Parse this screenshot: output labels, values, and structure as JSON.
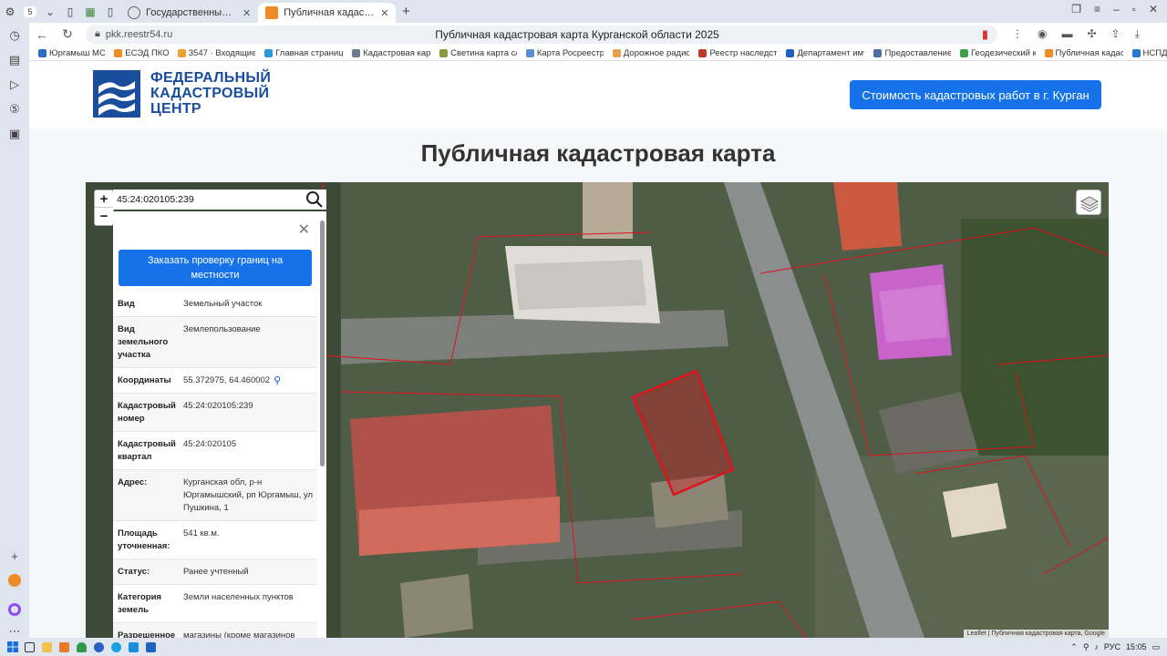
{
  "browser": {
    "tab_count": "5",
    "tabs": [
      {
        "label": "Государственный адресн",
        "active": false
      },
      {
        "label": "Публичная кадастров",
        "active": true
      }
    ],
    "url": "pkk.reestr54.ru",
    "title": "Публичная кадастровая карта Курганской области 2025"
  },
  "bookmarks": [
    "Юргамыш МО",
    "ЕСЭД ПКО",
    "3547 · Входящие",
    "Главная страница",
    "Кадастровая карт",
    "Светина карта с/",
    "Карта Росреестр",
    "Дорожное радио",
    "Реестр наследстe",
    "Департамент иму",
    "Предоставление",
    "Геодезический к",
    "Публичная кадас",
    "НСПД"
  ],
  "site": {
    "logo_line1": "ФЕДЕРАЛЬНЫЙ",
    "logo_line2": "КАДАСТРОВЫЙ",
    "logo_line3": "ЦЕНТР",
    "cta": "Стоимость кадастровых работ в г. Курган",
    "heading": "Публичная кадастровая карта"
  },
  "map": {
    "zoom_in": "+",
    "zoom_out": "−",
    "search_value": "45:24:020105:239",
    "attribution": "Leaflet | Публичная кадастровая карта, Google"
  },
  "panel": {
    "order_button": "Заказать проверку границ на местности",
    "rows": [
      {
        "key": "Вид",
        "value": "Земельный участок"
      },
      {
        "key": "Вид земельного участка",
        "value": "Землепользование"
      },
      {
        "key": "Координаты",
        "value": "55.372975, 64.460002"
      },
      {
        "key": "Кадастровый номер",
        "value": "45:24:020105:239"
      },
      {
        "key": "Кадастровый квартал",
        "value": "45:24:020105"
      },
      {
        "key": "Адрес:",
        "value": "Курганская обл, р-н Юргамышский, рп Юргамыш, ул Пушкина, 1"
      },
      {
        "key": "Площадь уточненная:",
        "value": "541 кв.м."
      },
      {
        "key": "Статус:",
        "value": "Ранее учтенный"
      },
      {
        "key": "Категория земель",
        "value": "Земли населенных пунктов"
      },
      {
        "key": "Разрешенное",
        "value": "магазины (кроме магазинов"
      }
    ]
  },
  "taskbar": {
    "lang": "РУС",
    "time": "15:05"
  },
  "colors": {
    "accent": "#1672e8",
    "brand": "#1a4d9c",
    "parcel_border": "#e0121b"
  }
}
